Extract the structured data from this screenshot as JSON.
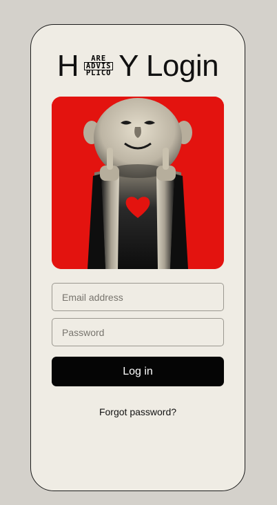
{
  "header": {
    "title_prefix": "H",
    "badge_top": "ARE",
    "badge_middle": "ADVIS",
    "badge_bottom": "PLICO",
    "title_suffix": "Y Login"
  },
  "hero": {
    "icon": "bald-figure-with-heart-illustration",
    "background_color": "#e3130f"
  },
  "form": {
    "email_placeholder": "Email address",
    "email_value": "",
    "password_placeholder": "Password",
    "password_value": "",
    "login_label": "Log in",
    "forgot_label": "Forgot password?"
  }
}
